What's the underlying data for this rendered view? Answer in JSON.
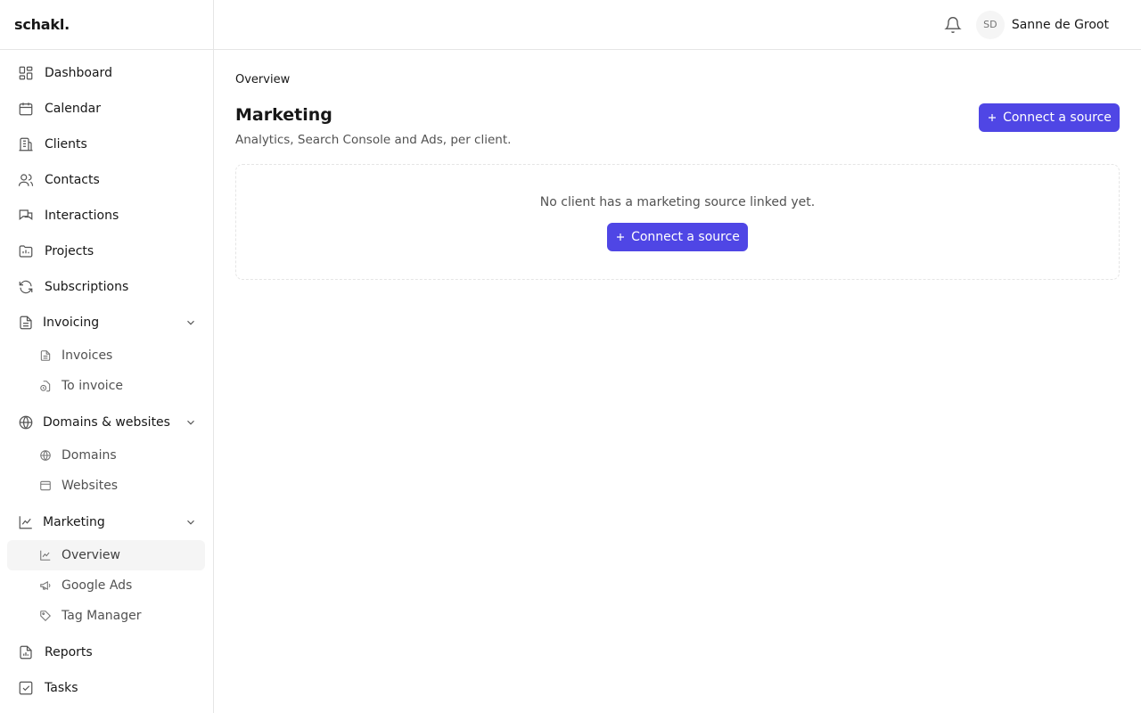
{
  "app": {
    "logo": "schakl."
  },
  "sidebar": {
    "items": [
      {
        "label": "Dashboard",
        "icon": "dashboard-icon"
      },
      {
        "label": "Calendar",
        "icon": "calendar-icon"
      },
      {
        "label": "Clients",
        "icon": "building-icon"
      },
      {
        "label": "Contacts",
        "icon": "users-icon"
      },
      {
        "label": "Interactions",
        "icon": "chat-icon"
      },
      {
        "label": "Projects",
        "icon": "folder-icon"
      },
      {
        "label": "Subscriptions",
        "icon": "refresh-icon"
      }
    ],
    "invoicing": {
      "label": "Invoicing",
      "children": [
        {
          "label": "Invoices",
          "icon": "file-icon"
        },
        {
          "label": "To invoice",
          "icon": "clock-file-icon"
        }
      ]
    },
    "domains": {
      "label": "Domains & websites",
      "children": [
        {
          "label": "Domains",
          "icon": "globe-icon"
        },
        {
          "label": "Websites",
          "icon": "browser-icon"
        }
      ]
    },
    "marketing": {
      "label": "Marketing",
      "children": [
        {
          "label": "Overview",
          "icon": "chart-line-icon",
          "active": true
        },
        {
          "label": "Google Ads",
          "icon": "megaphone-icon"
        },
        {
          "label": "Tag Manager",
          "icon": "tag-icon"
        }
      ]
    },
    "bottom": [
      {
        "label": "Reports",
        "icon": "report-icon"
      },
      {
        "label": "Tasks",
        "icon": "checkbox-icon"
      }
    ]
  },
  "header": {
    "user_initials": "SD",
    "user_name": "Sanne de Groot"
  },
  "main": {
    "breadcrumb": "Overview",
    "title": "Marketing",
    "subtitle": "Analytics, Search Console and Ads, per client.",
    "connect_label": "Connect a source",
    "empty_text": "No client has a marketing source linked yet.",
    "empty_connect_label": "Connect a source"
  },
  "colors": {
    "accent": "#4f46e5",
    "border": "#e5e5e5",
    "active_bg": "#f5f5f5"
  }
}
